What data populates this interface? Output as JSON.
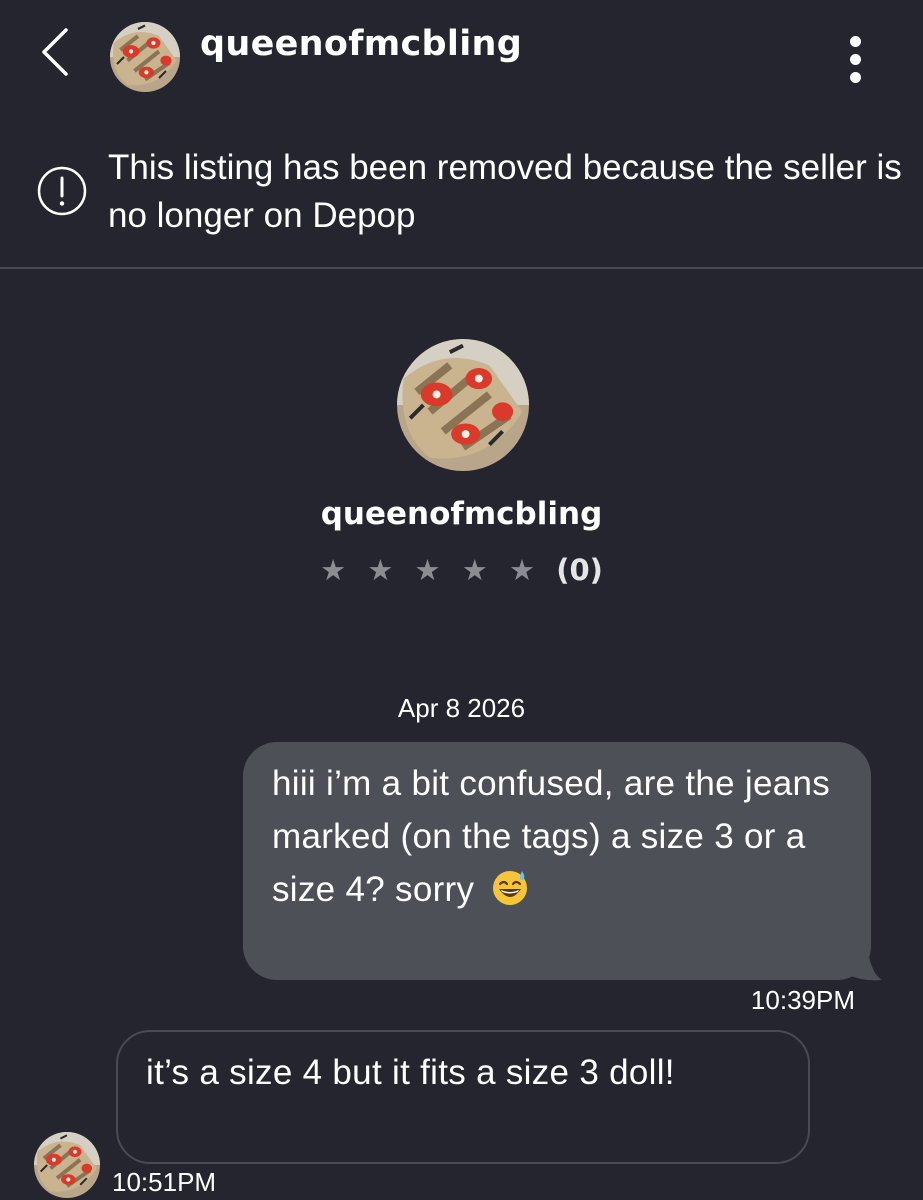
{
  "header": {
    "username": "queenofmcbling",
    "back_icon": "chevron-left-icon",
    "more_icon": "more-vertical-icon"
  },
  "notice": {
    "icon": "alert-circle-icon",
    "text": "This listing has been removed because the seller is no longer on Depop"
  },
  "profile": {
    "username": "queenofmcbling",
    "stars": "★ ★ ★ ★ ★",
    "rating_value": 0,
    "rating_count": "(0)"
  },
  "conversation": {
    "date": "Apr 8 2026",
    "messages": [
      {
        "direction": "outgoing",
        "text": "hiii i’m a bit confused, are the jeans marked (on the tags) a size 3 or a size 4? sorry",
        "emoji": "grinning-face-with-sweat-emoji",
        "time": "10:39PM"
      },
      {
        "direction": "incoming",
        "text": "it’s a size 4 but it fits a size 3 doll!",
        "time": "10:51PM"
      }
    ]
  },
  "colors": {
    "background": "#25252f",
    "outgoing_bubble": "#4d5157",
    "divider": "#4a4a56",
    "star": "#8c8c92"
  }
}
